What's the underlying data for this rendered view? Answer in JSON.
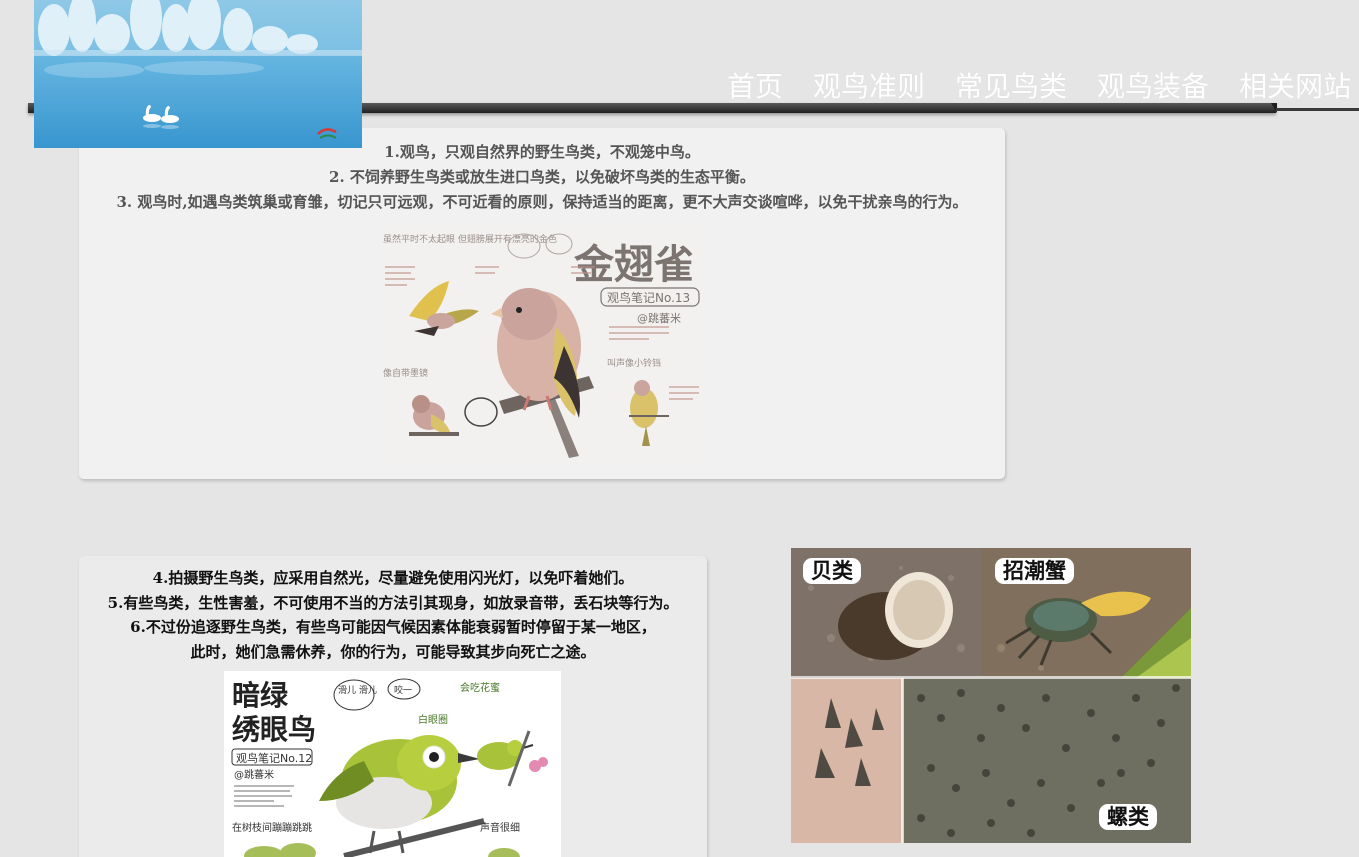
{
  "nav": {
    "items": [
      "首页",
      "观鸟准则",
      "常见鸟类",
      "观鸟装备",
      "相关网站"
    ]
  },
  "rules_panel_1": {
    "rules": [
      "1.观鸟，只观自然界的野生鸟类，不观笼中鸟。",
      "2. 不饲养野生鸟类或放生进口鸟类，以免破坏鸟类的生态平衡。",
      "3. 观鸟时,如遇鸟类筑巢或育雏，切记只可远观，不可近看的原则，保持适当的距离，更不大声交谈喧哗，以免干扰亲鸟的行为。"
    ]
  },
  "rules_panel_2": {
    "rules": [
      "4.拍摄野生鸟类，应采用自然光，尽量避免使用闪光灯，以免吓着她们。",
      "5.有些鸟类，生性害羞，不可使用不当的方法引其现身，如放录音带，丢石块等行为。",
      "6.不过份追逐野生鸟类，有些鸟可能因气候因素体能衰弱暂时停留于某一地区，",
      "此时，她们急需休养，你的行为，可能导致其步向死亡之途。"
    ]
  },
  "illustration_goldfinch": {
    "title": "金翅雀",
    "note": "观鸟笔记No.13",
    "author": "@跳蕃米",
    "notes": [
      "虽然平时不太起眼 但翅膀展开有漂亮的金色",
      "像自带墨镜",
      "叫声像小铃铛"
    ]
  },
  "illustration_whiteeye": {
    "title_line1": "暗绿",
    "title_line2": "绣眼鸟",
    "note": "观鸟笔记No.12",
    "author": "@跳蕃米",
    "notes": [
      "滑儿 滑儿",
      "咬一",
      "会吃花蜜",
      "白眼圈",
      "在树枝间蹦蹦跳跳",
      "声音很细"
    ]
  },
  "food_photo": {
    "labels": [
      "贝类",
      "招潮蟹",
      "螺类"
    ]
  },
  "colors": {
    "background": "#e5e5e5",
    "panel": "#f1f1f1",
    "header_bar": "#2b2b2b",
    "nav_text": "#ffffff"
  }
}
